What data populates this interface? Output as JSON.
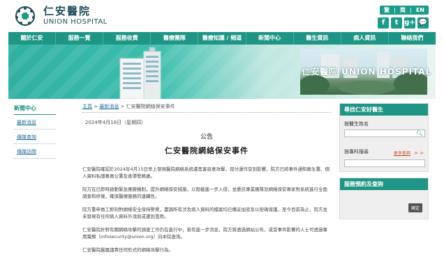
{
  "header": {
    "logo_cn": "仁安醫院",
    "logo_en": "UNION HOSPITAL",
    "lang_trad": "繁",
    "lang_simp": "简",
    "lang_en": "EN",
    "social": [
      "f",
      "t",
      "g+",
      "💬"
    ]
  },
  "nav": {
    "items": [
      "關於仁安",
      "服務一覽",
      "服務收費",
      "醫療團隊",
      "醫療知識 / 頻道",
      "新聞中心",
      "醫生資訊",
      "病人資訊",
      "聯絡我們"
    ]
  },
  "banner": {
    "logo_text": "仁安醫院 UNION HOSPITAL"
  },
  "left_sidebar": {
    "title": "新聞中心",
    "items": [
      "最新消息",
      "傳媒查詢",
      "傳媒訪問"
    ]
  },
  "main": {
    "breadcrumb": {
      "home": "主頁",
      "sep": " > ",
      "news": "最新消息",
      "current": " > 仁安醫院網絡保安事件"
    },
    "date": "2024年4月18日（星期四）",
    "notice_title": "公告",
    "heading": "仁安醫院網絡保安事件",
    "paragraphs": [
      "仁安醫院確認於2024年4月15日早上發現醫院網絡系統遭黑客惡意攻擊，部分運作受到影響，院方已將事件通知衞生署、個人資料私隱專員公署及香港警務處。",
      "院方在已即時啟動緊急應變機制，提升網絡保安措施，以阻截進一步入侵，並委託專業團隊及網絡保安專家對系統進行全面調查和修復，確保醫療服務的連續性。",
      "院方重申員工即刻對網絡安全保持警覺，盡調所有涉及病人資料的檔案均已備妥加密及以密碼保護，至今目前為止，院方並未發現有任何病人資料外洩與或遭到濫用。",
      "仁安醫院針對有關網絡攻擊的調查工作仍在進行中，若有進一步消息，院方將透過網站公布，或受事件影響的人士可透過專用電郵（infosecurity@union.org）向本院查詢。",
      "仁安醫院嚴厲譴責任何形式的網絡攻擊行為。"
    ]
  },
  "right_sidebar": {
    "doctor_search": {
      "header": "尋找仁安好醫生",
      "name_label": "按醫生姓名",
      "specialty_label": "按專科搜尋",
      "more_link": "更多查詢",
      "arrows": "> >"
    },
    "booking": {
      "header": "服務預約及查詢",
      "button": "確定"
    }
  },
  "colors": {
    "brand_teal": "#1e9585",
    "link_blue": "#1e6fa0",
    "accent_orange": "#c05020"
  }
}
